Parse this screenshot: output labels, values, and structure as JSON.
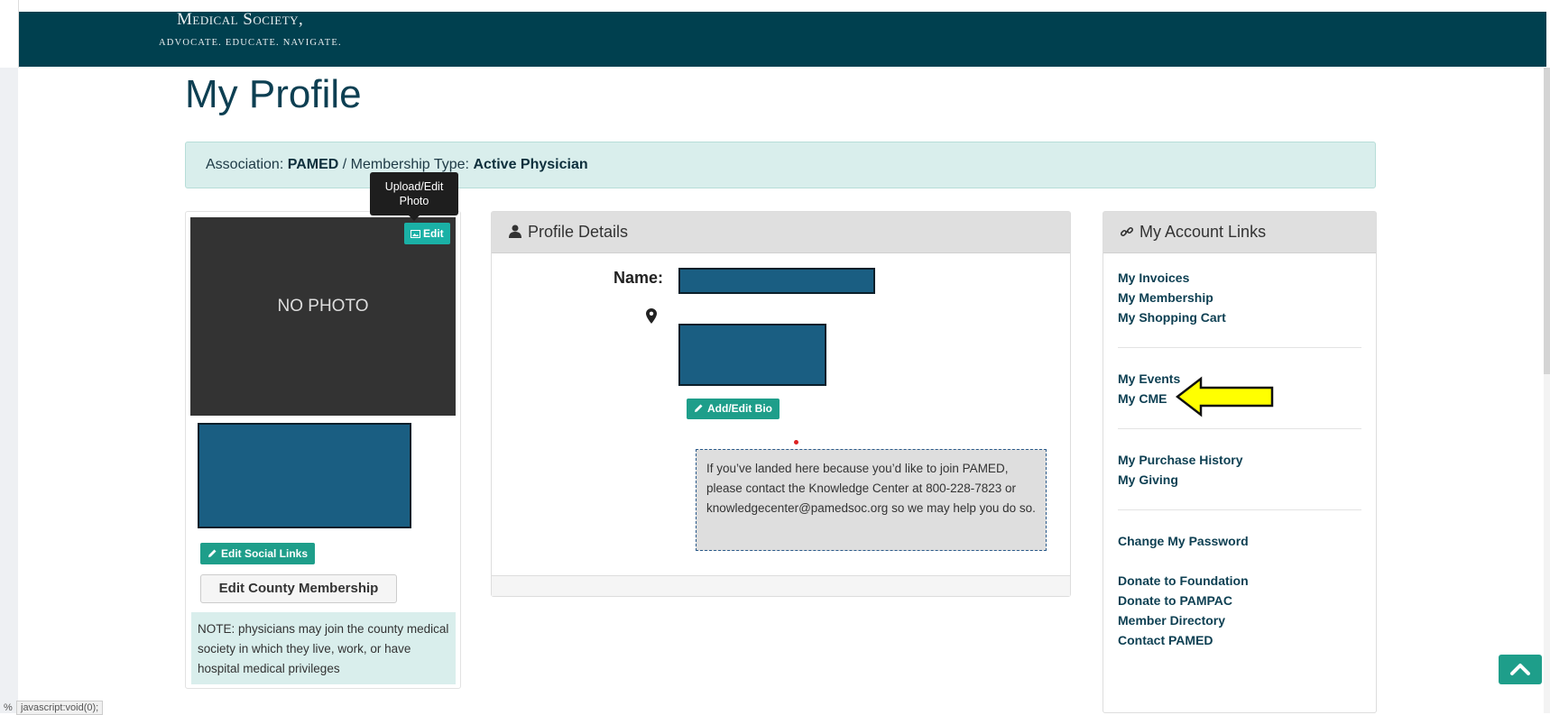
{
  "header": {
    "brand_name": "Medical Society,",
    "brand_tagline": "ADVOCATE. EDUCATE. NAVIGATE.",
    "background_color": "#00404f"
  },
  "page": {
    "title": "My Profile"
  },
  "association_banner": {
    "association_label": "Association:",
    "association_value": "PAMED",
    "separator": "/",
    "membership_label": "Membership Type:",
    "membership_value": "Active Physician"
  },
  "photo_card": {
    "tooltip": "Upload/Edit Photo",
    "edit_button": "Edit",
    "no_photo_text": "NO PHOTO",
    "edit_social_button": "Edit Social Links",
    "edit_county_button": "Edit County Membership",
    "note": "NOTE: physicians may join the county medical society in which they live, work, or have hospital medical privileges"
  },
  "profile_details": {
    "heading": "Profile Details",
    "name_label": "Name:",
    "add_bio_button": "Add/Edit Bio",
    "join_message": "If you’ve landed here because you’d like to join PAMED, please contact the Knowledge Center at 800-228-7823 or knowledgecenter@pamedsoc.org so we may help you do so."
  },
  "account_links": {
    "heading": "My Account Links",
    "groups": [
      [
        "My Invoices",
        "My Membership",
        "My Shopping Cart"
      ],
      [
        "My Events",
        "My CME"
      ],
      [
        "My Purchase History",
        "My Giving"
      ],
      [
        "Change My Password"
      ],
      [
        "Donate to Foundation",
        "Donate to PAMPAC",
        "Member Directory",
        "Contact PAMED"
      ]
    ]
  },
  "status_bar": {
    "percent": "%",
    "url": "javascript:void(0);"
  },
  "colors": {
    "accent_teal": "#1e9e8a",
    "link_color": "#0d3f52",
    "banner_bg": "#d9eeec",
    "annotation_arrow": "#ffff00"
  }
}
